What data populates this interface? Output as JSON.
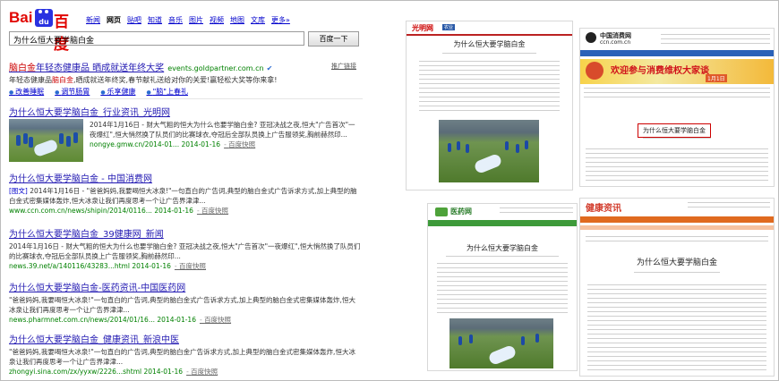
{
  "baidu": {
    "logo_left": "Bai",
    "logo_paw": "du",
    "logo_right": "百度",
    "nav": [
      "新闻",
      "网页",
      "贴吧",
      "知道",
      "音乐",
      "图片",
      "视频",
      "地图",
      "文库",
      "更多»"
    ],
    "search_value": "为什么恒大要学脑白金",
    "search_button": "百度一下",
    "ad": {
      "title_pre": "脑白金",
      "title_post": "年轻态健康品 晒成就送年终大奖",
      "url": "events.goldpartner.com.cn",
      "tag": "推广链接",
      "desc_pre": "年轻态健康品",
      "desc_hl": "脑白金",
      "desc_post": ",晒成就送年终奖,春节献礼送给对你的关爱!赢轻松大奖等你来拿!",
      "links": [
        "改善睡眠",
        "调节肠胃",
        "乐享健康",
        "\"脑\"上春礼"
      ]
    },
    "results": [
      {
        "title": "为什么恒大要学脑白金_行业资讯_光明网",
        "desc": "2014年1月16日 - 财大气粗的恒大为什么也要学脑白金? 亚冠决战之夜,恒大\"广告首次\"一夜爆红\",恒大悄然换了队员们的比赛球衣,夺冠后全部队员换上广告服领奖,胸前赫然印...",
        "url": "nongye.gmw.cn/2014-01...",
        "date": "2014-01-16",
        "cache": "百度快照"
      },
      {
        "title": "为什么恒大要学脑白金 - 中国消费网",
        "tag": "[图文]",
        "desc": "2014年1月16日 - \"爸爸妈妈,我要喝恒大冰泉!\"一句直白的广告词,典型的脑白金式广告诉求方式,加上典型的脑白金式密集媒体轰炸,恒大冰泉让我们再度思考一个让广告界津津...",
        "url": "www.ccn.com.cn/news/shipin/2014/0116...",
        "date": "2014-01-16",
        "cache": "百度快照"
      },
      {
        "title": "为什么恒大要学脑白金_39健康网_新闻",
        "desc": "2014年1月16日 - 财大气粗的恒大为什么也要学脑白金? 亚冠决战之夜,恒大\"广告首次\"一夜爆红\",恒大悄然换了队员们的比赛球衣,夺冠后全部队员换上广告服领奖,胸前赫然印...",
        "url": "news.39.net/a/140116/43283...html",
        "date": "2014-01-16",
        "cache": "百度快照"
      },
      {
        "title": "为什么恒大要学脑白金-医药资讯-中国医药网",
        "desc": "\"爸爸妈妈,我要喝恒大冰泉!\"一句直白的广告词,典型的脑白金式广告诉求方式,加上典型的脑白金式密集媒体轰炸,恒大冰泉让我们再度思考一个让广告界津津...",
        "url": "news.pharmnet.com.cn/news/2014/01/16...",
        "date": "2014-01-16",
        "cache": "百度快照"
      },
      {
        "title": "为什么恒大要学脑白金_健康资讯_新浪中医",
        "desc": "\"爸爸妈妈,我要喝恒大冰泉!\"一句直白的广告词,典型的脑白金广告诉求方式,加上典型的脑白金式密集媒体轰炸,恒大冰泉让我们再度思考一个让广告界津津...",
        "url": "zhongyi.sina.com/zx/yyxw/2226...shtml",
        "date": "2014-01-16",
        "cache": "百度快照"
      }
    ]
  },
  "shots": {
    "gmw": {
      "logo": "光明网",
      "badge": "农业",
      "title": "为什么恒大要学脑白金"
    },
    "ccn": {
      "logo_cn": "中国消费网",
      "logo_en": "ccn.com.cn",
      "banner": "欢迎参与消费维权大家谈",
      "banner_date": "1月1日",
      "title": "为什么恒大要学脑白金",
      "intro": "\"爸爸妈妈,我要喝恒大冰泉!\"一句直白的广告词,典型的脑白金式广告诉求方式,加上典型的脑白金式密集媒体轰炸,恒大冰泉让我们再度思考一个让广告界津津..."
    },
    "pharm": {
      "logo": "医药网",
      "title": "为什么恒大要学脑白金"
    },
    "sina": {
      "header": "健康资讯",
      "title": "为什么恒大要学脑白金"
    }
  },
  "colors": {
    "baidu_red": "#e10602",
    "baidu_blue": "#2932e1",
    "link": "#2219b2",
    "url_green": "#008000",
    "highlight": "#c00"
  }
}
